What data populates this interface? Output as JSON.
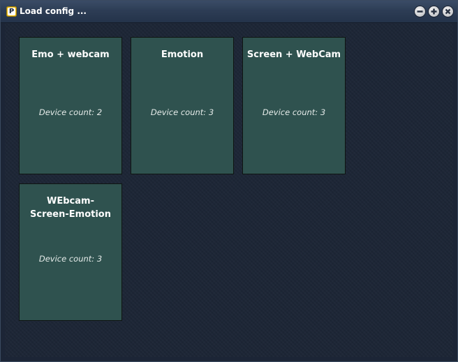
{
  "window": {
    "title": "Load config ...",
    "app_icon_letter": "P",
    "buttons": [
      "minimize-icon",
      "maximize-icon",
      "close-icon"
    ]
  },
  "configs": [
    {
      "name": "Emo + webcam",
      "device_count": "Device count: 2"
    },
    {
      "name": "Emotion",
      "device_count": "Device count: 3"
    },
    {
      "name": "Screen + WebCam",
      "device_count": "Device count: 3"
    },
    {
      "name": "WEbcam-Screen-Emotion",
      "device_count": "Device count: 3"
    }
  ],
  "colors": {
    "card_bg": "#2f524f",
    "window_bg": "#1c2536",
    "titlebar": "#2d3d55"
  }
}
